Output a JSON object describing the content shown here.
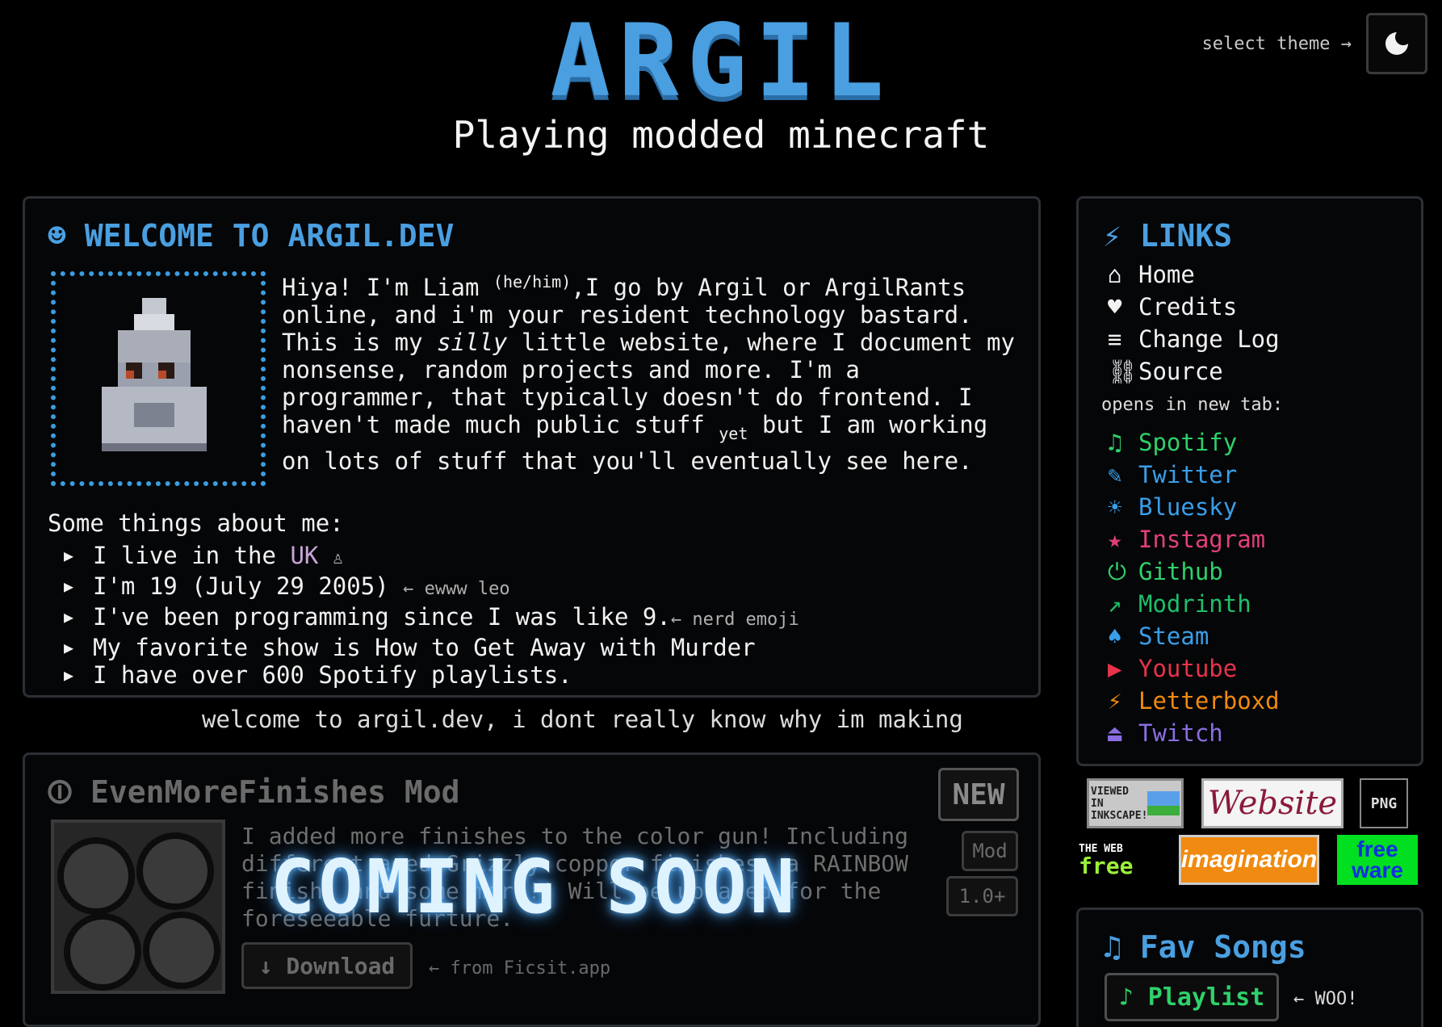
{
  "header": {
    "title": "ARGIL",
    "subtitle": "Playing modded minecraft",
    "theme_label": "select theme →"
  },
  "welcome": {
    "icon": "smiley-icon",
    "heading": "WELCOME TO ARGIL.DEV",
    "intro_1": "Hiya! I'm Liam",
    "intro_pronouns": "(he/him)",
    "intro_2": ",I go by Argil or ArgilRants online, and i'm your resident technology bastard. This is my",
    "intro_em": "silly",
    "intro_3": "little website, where I document my nonsense, random projects and more. I'm a programmer, that typically doesn't do frontend. I haven't made much public stuff",
    "intro_yet": "yet",
    "intro_4": "but I am working on lots of stuff that you'll eventually see here.",
    "facts_title": "Some things about me:",
    "facts": [
      {
        "text": "I live in the ",
        "highlight": "UK",
        "note": "♙"
      },
      {
        "text": "I'm 19 (July 29 2005)",
        "note": "← ewww leo"
      },
      {
        "text": "I've been programming since I was like 9.",
        "note": "← nerd emoji"
      },
      {
        "text": "My favorite show is How to Get Away with Murder",
        "note": ""
      },
      {
        "text": "I have over 600 Spotify playlists.",
        "note": ""
      }
    ]
  },
  "ticker": "welcome to argil.dev, i dont really know why im making",
  "mod": {
    "icon": "power-icon",
    "heading": "EvenMoreFinishes Mod",
    "description": "I added more finishes to the color gun! Including different aged Grizzly copper finishes, a RAINBOW finish, and some more!! Will be updated for the foreseeable furture.",
    "download_label": "↓ Download",
    "download_note": "← from Ficsit.app",
    "new_label": "NEW",
    "tag_mod": "Mod",
    "tag_version": "1.0+",
    "overlay": "COMING SOON"
  },
  "links": {
    "icon": "lightning-icon",
    "heading": "LINKS",
    "site": [
      {
        "icon": "home-icon",
        "glyph": "⌂",
        "label": "Home"
      },
      {
        "icon": "heart-icon",
        "glyph": "♥",
        "label": "Credits"
      },
      {
        "icon": "list-icon",
        "glyph": "≡",
        "label": "Change Log"
      },
      {
        "icon": "link-icon",
        "glyph": "⛓",
        "label": "Source"
      }
    ],
    "new_tab_label": "opens in new tab:",
    "social": [
      {
        "icon": "music-note-icon",
        "glyph": "♫",
        "label": "Spotify",
        "color": "#2fd06a"
      },
      {
        "icon": "bird-icon",
        "glyph": "✎",
        "label": "Twitter",
        "color": "#3a9ee8"
      },
      {
        "icon": "butterfly-icon",
        "glyph": "☀",
        "label": "Bluesky",
        "color": "#3a9ee8"
      },
      {
        "icon": "camera-icon",
        "glyph": "★",
        "label": "Instagram",
        "color": "#e0407a"
      },
      {
        "icon": "github-icon",
        "glyph": "⏻",
        "label": "Github",
        "color": "#2fd06a"
      },
      {
        "icon": "modrinth-icon",
        "glyph": "↗",
        "label": "Modrinth",
        "color": "#1fbf6a"
      },
      {
        "icon": "steam-icon",
        "glyph": "♠",
        "label": "Steam",
        "color": "#3a9ee8"
      },
      {
        "icon": "play-icon",
        "glyph": "▶",
        "label": "Youtube",
        "color": "#e8334a"
      },
      {
        "icon": "letterboxd-icon",
        "glyph": "⚡",
        "label": "Letterboxd",
        "color": "#f08a10"
      },
      {
        "icon": "twitch-icon",
        "glyph": "⏏",
        "label": "Twitch",
        "color": "#8a6ee0"
      }
    ]
  },
  "badges": {
    "inkscape": "VIEWED IN INKSCAPE!",
    "website": "Website",
    "png": "PNG",
    "freeweb_top": "THE WEB",
    "freeweb_bottom": "free",
    "imagination": "imagination",
    "freeware_top": "free",
    "freeware_bottom": "ware"
  },
  "songs": {
    "icon": "music-icon",
    "heading": "Fav Songs",
    "playlist_label": "♪ Playlist",
    "playlist_note": "← WOO!"
  }
}
